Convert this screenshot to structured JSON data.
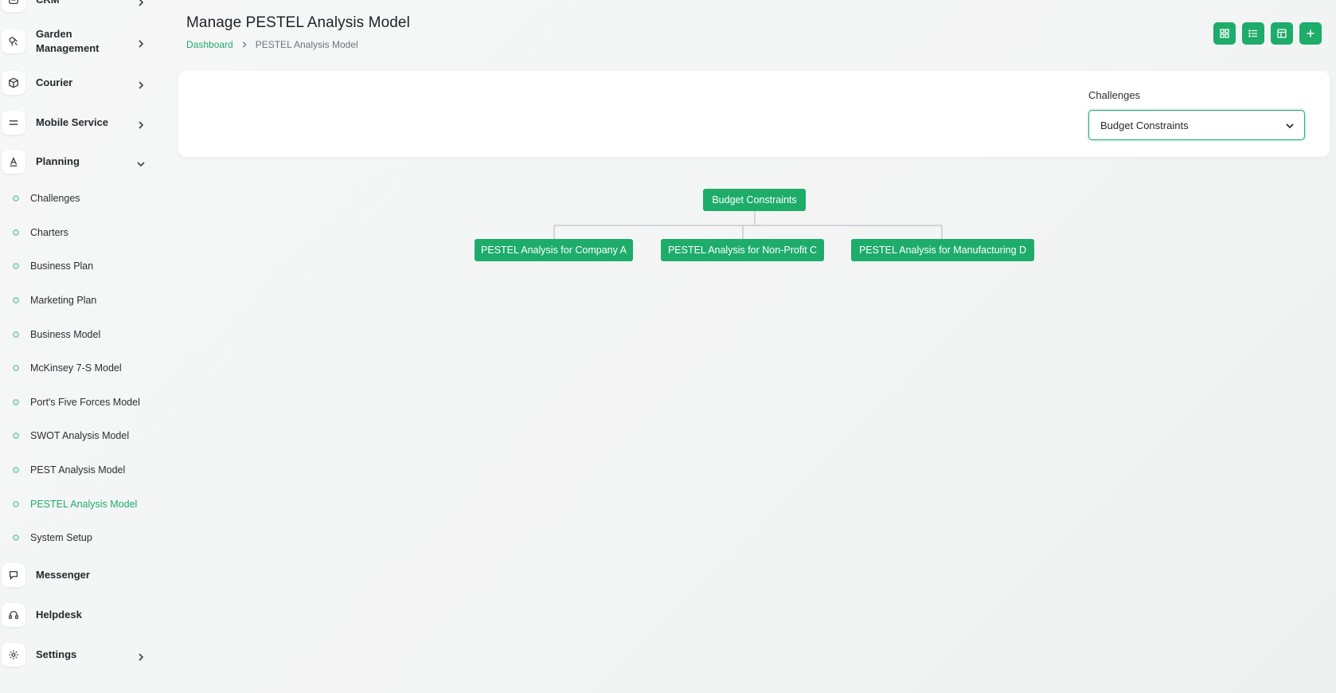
{
  "colors": {
    "accent": "#1eac6b",
    "connector": "#c8cccf"
  },
  "sidebar": {
    "partial_top": {
      "label": "CRM",
      "icon": "crm-icon"
    },
    "items": [
      {
        "label": "Garden Management",
        "icon": "garden-icon",
        "expandable": true
      },
      {
        "label": "Courier",
        "icon": "box-icon",
        "expandable": true
      },
      {
        "label": "Mobile Service",
        "icon": "menu-lines-icon",
        "expandable": true
      },
      {
        "label": "Planning",
        "icon": "planning-icon",
        "expandable": true,
        "expanded": true
      },
      {
        "label": "Messenger",
        "icon": "chat-icon",
        "expandable": false
      },
      {
        "label": "Helpdesk",
        "icon": "headset-icon",
        "expandable": false
      },
      {
        "label": "Settings",
        "icon": "gear-icon",
        "expandable": true
      }
    ],
    "planning_children": [
      "Challenges",
      "Charters",
      "Business Plan",
      "Marketing Plan",
      "Business Model",
      "McKinsey 7-S Model",
      "Port's Five Forces Model",
      "SWOT Analysis Model",
      "PEST Analysis Model",
      "PESTEL Analysis Model",
      "System Setup"
    ],
    "active_child": "PESTEL Analysis Model"
  },
  "header": {
    "title": "Manage PESTEL Analysis Model",
    "breadcrumb": {
      "home": "Dashboard",
      "current": "PESTEL Analysis Model"
    }
  },
  "toolbar": {
    "buttons": [
      "grid-view-icon",
      "list-view-icon",
      "table-view-icon",
      "plus-icon"
    ]
  },
  "filter": {
    "label": "Challenges",
    "selected": "Budget Constraints"
  },
  "tree": {
    "root": "Budget Constraints",
    "children": [
      "PESTEL Analysis for Company A",
      "PESTEL Analysis for Non-Profit C",
      "PESTEL Analysis for Manufacturing D"
    ]
  }
}
